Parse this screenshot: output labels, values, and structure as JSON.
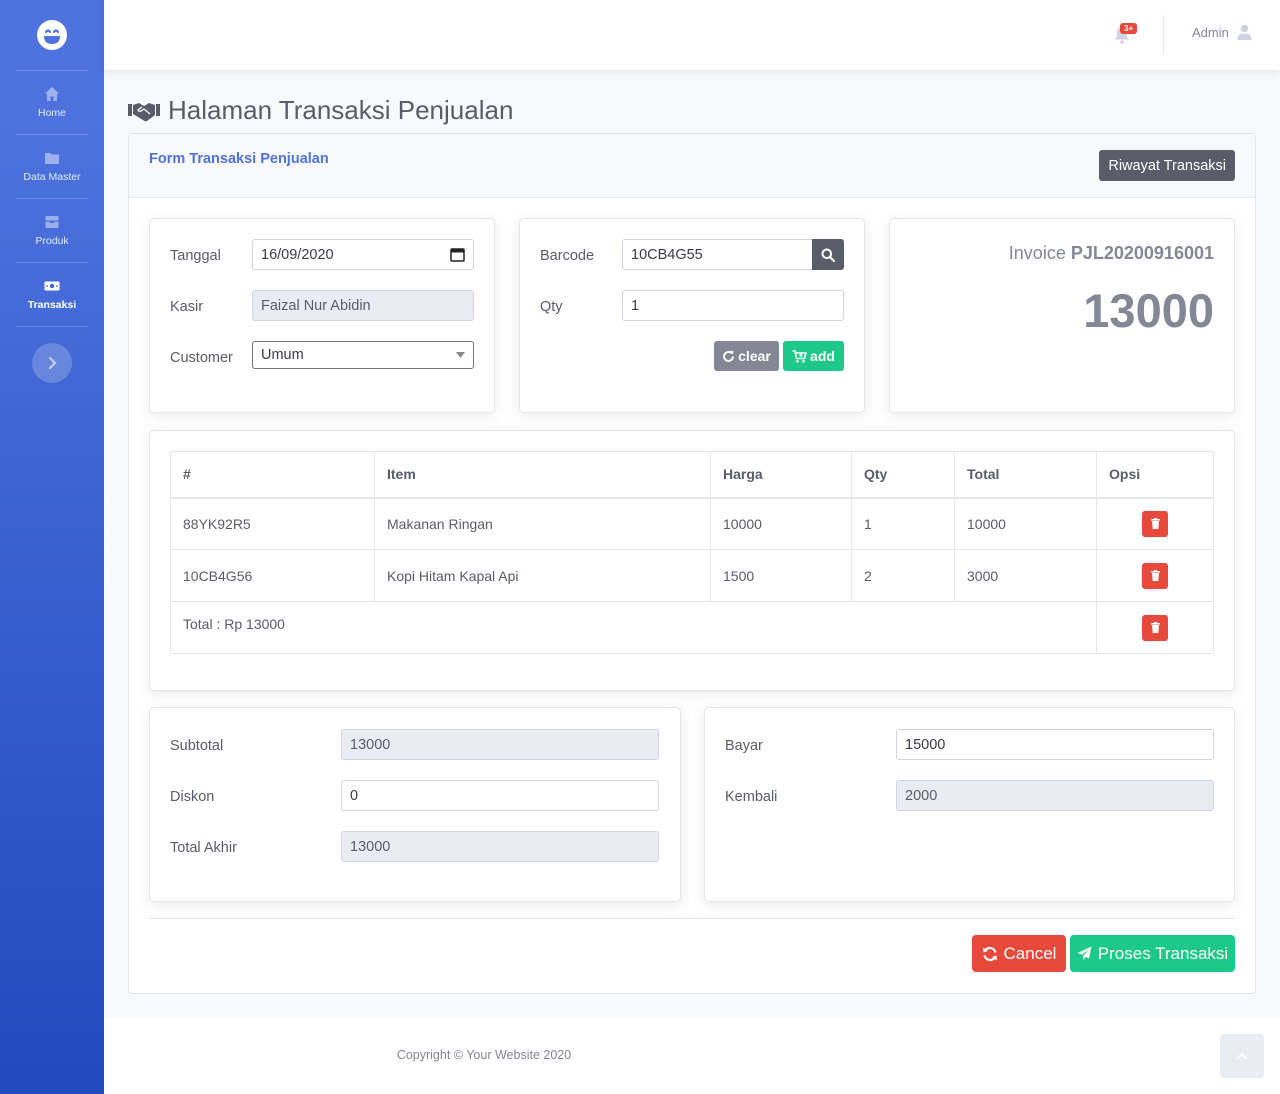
{
  "sidebar": {
    "items": [
      {
        "label": "Home",
        "icon": "home-icon"
      },
      {
        "label": "Data Master",
        "icon": "folder-icon"
      },
      {
        "label": "Produk",
        "icon": "box-icon"
      },
      {
        "label": "Transaksi",
        "icon": "money-icon"
      }
    ]
  },
  "topbar": {
    "badge": "3+",
    "user": "Admin"
  },
  "page": {
    "title": "Halaman Transaksi Penjualan"
  },
  "card": {
    "title": "Form Transaksi Penjualan",
    "riwayat_label": "Riwayat Transaksi"
  },
  "form_left": {
    "tanggal_label": "Tanggal",
    "tanggal_value": "16/09/2020",
    "kasir_label": "Kasir",
    "kasir_value": "Faizal Nur Abidin",
    "customer_label": "Customer",
    "customer_value": "Umum"
  },
  "form_mid": {
    "barcode_label": "Barcode",
    "barcode_value": "10CB4G55",
    "qty_label": "Qty",
    "qty_value": "1",
    "clear_label": "clear",
    "add_label": "add"
  },
  "invoice": {
    "prefix": "Invoice",
    "number": "PJL20200916001",
    "total": "13000"
  },
  "table": {
    "headers": [
      "#",
      "Item",
      "Harga",
      "Qty",
      "Total",
      "Opsi"
    ],
    "rows": [
      [
        "88YK92R5",
        "Makanan Ringan",
        "10000",
        "1",
        "10000"
      ],
      [
        "10CB4G56",
        "Kopi Hitam Kapal Api",
        "1500",
        "2",
        "3000"
      ]
    ],
    "total_label": "Total : Rp 13000"
  },
  "summary": {
    "subtotal_label": "Subtotal",
    "subtotal_value": "13000",
    "diskon_label": "Diskon",
    "diskon_value": "0",
    "total_akhir_label": "Total Akhir",
    "total_akhir_value": "13000"
  },
  "payment": {
    "bayar_label": "Bayar",
    "bayar_value": "15000",
    "kembali_label": "Kembali",
    "kembali_value": "2000"
  },
  "actions": {
    "cancel_label": "Cancel",
    "proses_label": "Proses Transaksi"
  },
  "footer": {
    "copyright": "Copyright © Your Website 2020"
  },
  "colors": {
    "primary": "#4e73df",
    "success": "#1cc88a",
    "danger": "#e74a3b",
    "secondary": "#858796",
    "dark": "#5a5c69"
  }
}
